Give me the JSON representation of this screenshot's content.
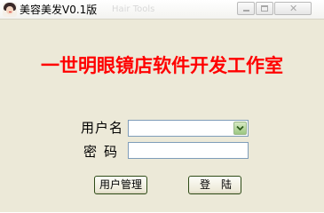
{
  "window": {
    "title": "美容美发V0.1版",
    "title_ghost": "Hair Tools"
  },
  "titlebar_controls": {
    "close_glyph": "✕"
  },
  "heading": "一世明眼镜店软件开发工作室",
  "form": {
    "username_label": "用户名",
    "username_value": "",
    "password_label": "密码",
    "password_value": ""
  },
  "buttons": {
    "user_management": "用户管理",
    "login": "登陆"
  },
  "colors": {
    "heading": "#ff0000",
    "window_bg": "#ece9d8",
    "combo_button": "#9cc781"
  },
  "icons": {
    "app": "salon-face-icon",
    "combo": "chevron-down-icon"
  }
}
